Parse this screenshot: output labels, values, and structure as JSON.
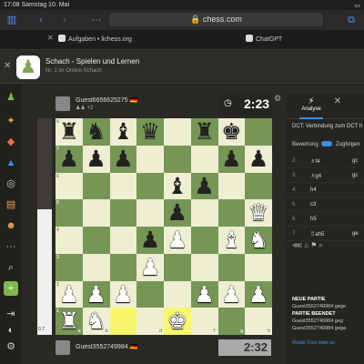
{
  "statusbar": {
    "time": "17:08",
    "date": "Samstag 10. Mai"
  },
  "browser": {
    "sidebar_icon": "sidebar-icon",
    "back_icon": "back-icon",
    "forward_icon": "forward-icon",
    "url": "chess.com",
    "lock_icon": "lock-icon",
    "tabs": [
      {
        "label": "Aufgaben • lichess.org"
      },
      {
        "label": "ChatGPT"
      }
    ]
  },
  "banner": {
    "title": "Schach - Spielen und Lernen",
    "subtitle": "Nr. 1 im Online-Schach"
  },
  "sidebar": {
    "items": [
      "pawn-logo-icon",
      "puzzle-icon",
      "lessons-icon",
      "learn-icon",
      "watch-icon",
      "news-icon",
      "community-icon",
      "more-icon",
      "search-icon",
      "add-friend-icon",
      "login-icon",
      "theme-icon",
      "settings-icon"
    ]
  },
  "top_player": {
    "name": "Guest6656625275",
    "flag": "🇩🇪",
    "sub": "+2",
    "clock": "2:23"
  },
  "bottom_player": {
    "name": "Guest3552749984",
    "flag": "🇩🇪",
    "clock": "2:32"
  },
  "eval": {
    "value": "0.7",
    "white_fraction": 0.58
  },
  "board": {
    "ranks": [
      "8",
      "7",
      "6",
      "5",
      "4",
      "3",
      "2",
      "1"
    ],
    "files": [
      "a",
      "b",
      "c",
      "d",
      "e",
      "f",
      "g",
      "h"
    ],
    "highlight": [
      "c1",
      "e1"
    ],
    "pieces": [
      {
        "sq": "a8",
        "p": "♜",
        "c": "b"
      },
      {
        "sq": "b8",
        "p": "♞",
        "c": "b"
      },
      {
        "sq": "c8",
        "p": "♝",
        "c": "b"
      },
      {
        "sq": "d8",
        "p": "♛",
        "c": "b"
      },
      {
        "sq": "f8",
        "p": "♜",
        "c": "b"
      },
      {
        "sq": "g8",
        "p": "♚",
        "c": "b"
      },
      {
        "sq": "a7",
        "p": "♟",
        "c": "b"
      },
      {
        "sq": "b7",
        "p": "♟",
        "c": "b"
      },
      {
        "sq": "c7",
        "p": "♟",
        "c": "b"
      },
      {
        "sq": "g7",
        "p": "♟",
        "c": "b"
      },
      {
        "sq": "h7",
        "p": "♟",
        "c": "b"
      },
      {
        "sq": "e6",
        "p": "♝",
        "c": "b"
      },
      {
        "sq": "f6",
        "p": "♟",
        "c": "b"
      },
      {
        "sq": "e5",
        "p": "♟",
        "c": "b"
      },
      {
        "sq": "h5",
        "p": "♕",
        "c": "w"
      },
      {
        "sq": "d4",
        "p": "♟",
        "c": "b"
      },
      {
        "sq": "e4",
        "p": "♙",
        "c": "w"
      },
      {
        "sq": "g4",
        "p": "♗",
        "c": "w"
      },
      {
        "sq": "h4",
        "p": "♘",
        "c": "w"
      },
      {
        "sq": "d3",
        "p": "♙",
        "c": "w"
      },
      {
        "sq": "a2",
        "p": "♙",
        "c": "w"
      },
      {
        "sq": "b2",
        "p": "♙",
        "c": "w"
      },
      {
        "sq": "c2",
        "p": "♙",
        "c": "w"
      },
      {
        "sq": "f2",
        "p": "♙",
        "c": "w"
      },
      {
        "sq": "g2",
        "p": "♙",
        "c": "w"
      },
      {
        "sq": "h2",
        "p": "♙",
        "c": "w"
      },
      {
        "sq": "a1",
        "p": "♖",
        "c": "w"
      },
      {
        "sq": "b1",
        "p": "♘",
        "c": "w"
      },
      {
        "sq": "e1",
        "p": "♔",
        "c": "w"
      }
    ]
  },
  "panel": {
    "tabs": [
      {
        "label": "Analyse",
        "icon": "bolt-icon"
      },
      {
        "label": "",
        "icon": "close-icon"
      }
    ],
    "opening": "DCT: Verbindung zum DCT h",
    "eval_label": "Bewertung",
    "eval_toggle_label": "Zugfolgen",
    "moves": [
      {
        "n": "2.",
        "w": "♗f4",
        "b": "gc"
      },
      {
        "n": "3.",
        "w": "♗g4",
        "b": "gc"
      },
      {
        "n": "4.",
        "w": "h4",
        "b": ""
      },
      {
        "n": "5.",
        "w": "c3",
        "b": ""
      },
      {
        "n": "6.",
        "w": "h5",
        "b": ""
      },
      {
        "n": "7.",
        "w": "♖ah5",
        "b": "ge"
      }
    ],
    "chat": {
      "new_game": "NEUE PARTIE",
      "line1": "Guest3552749984 gege",
      "game_over": "PARTIE BEENDET",
      "line2": "Guest3552749984 geg",
      "line3": "Guest3552749984 gega",
      "footer": "Melde Dich bitte an"
    }
  }
}
